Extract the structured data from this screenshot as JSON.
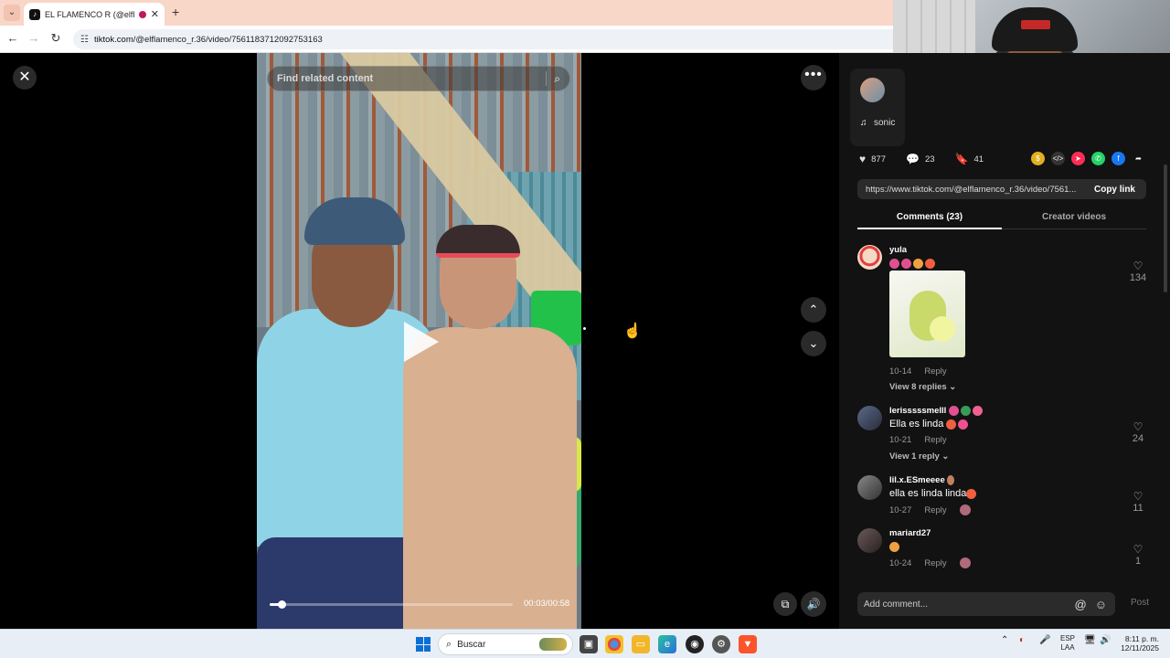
{
  "browser": {
    "tab_title": "EL FLAMENCO R",
    "tab_handle": "(@elflame",
    "url_host": "tiktok.com",
    "url_path": "/@elflamenco_r.36/video/7561183712092753163"
  },
  "video": {
    "search_placeholder": "Find related content",
    "time": "00:03/00:58",
    "progress": 0.05
  },
  "panel": {
    "music": "sonic",
    "likes": "877",
    "comments": "23",
    "saves": "41",
    "link": "https://www.tiktok.com/@elflamenco_r.36/video/7561...",
    "copy_link": "Copy link",
    "tab_comments": "Comments (23)",
    "tab_creator": "Creator videos",
    "add_comment": "Add comment...",
    "post": "Post"
  },
  "comments": [
    {
      "user": "yula",
      "text": "",
      "date": "10-14",
      "reply": "Reply",
      "likes": "134",
      "replies": "View 8 replies",
      "has_sticker": true
    },
    {
      "user": "lerisssssmelll",
      "text": "Ella es linda",
      "date": "10-21",
      "reply": "Reply",
      "likes": "24",
      "replies": "View 1 reply"
    },
    {
      "user": "lil.x.ESmeeee",
      "text": "ella es linda linda",
      "date": "10-27",
      "reply": "Reply",
      "likes": "11"
    },
    {
      "user": "mariard27",
      "text": "",
      "date": "10-24",
      "reply": "Reply",
      "likes": "1"
    }
  ],
  "taskbar": {
    "search": "Buscar",
    "lang_1": "ESP",
    "lang_2": "LAA",
    "time": "8:11 p. m.",
    "date": "12/11/2025"
  },
  "colors": {
    "tab_strip": "#f8d6c8",
    "panel_bg": "#121212",
    "accent_red": "#fe2c55"
  }
}
